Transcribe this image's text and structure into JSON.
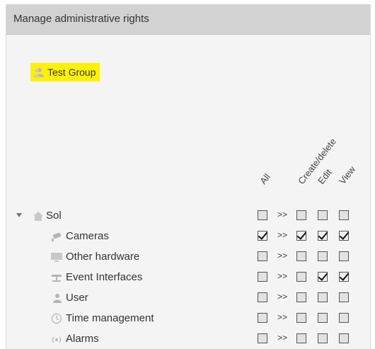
{
  "header": {
    "title": "Manage administrative rights"
  },
  "group": {
    "label": "Test Group",
    "highlight_color": "#fff200"
  },
  "columns": {
    "all": "All",
    "create_delete": "Create/delete",
    "edit": "Edit",
    "view": "View",
    "cascade_symbol": ">>"
  },
  "tree": {
    "root": {
      "label": "Sol",
      "icon": "home-icon",
      "expanded": true,
      "all": false,
      "create_delete": false,
      "edit": false,
      "view": false
    },
    "items": [
      {
        "label": "Cameras",
        "icon": "camera-icon",
        "all": true,
        "create_delete": true,
        "edit": true,
        "view": true
      },
      {
        "label": "Other hardware",
        "icon": "monitor-icon",
        "all": false,
        "create_delete": false,
        "edit": false,
        "view": false
      },
      {
        "label": "Event Interfaces",
        "icon": "network-icon",
        "all": false,
        "create_delete": false,
        "edit": true,
        "view": true
      },
      {
        "label": "User",
        "icon": "user-icon",
        "all": false,
        "create_delete": false,
        "edit": false,
        "view": false
      },
      {
        "label": "Time management",
        "icon": "clock-icon",
        "all": false,
        "create_delete": false,
        "edit": false,
        "view": false
      },
      {
        "label": "Alarms",
        "icon": "alarm-icon",
        "all": false,
        "create_delete": false,
        "edit": false,
        "view": false
      }
    ]
  }
}
